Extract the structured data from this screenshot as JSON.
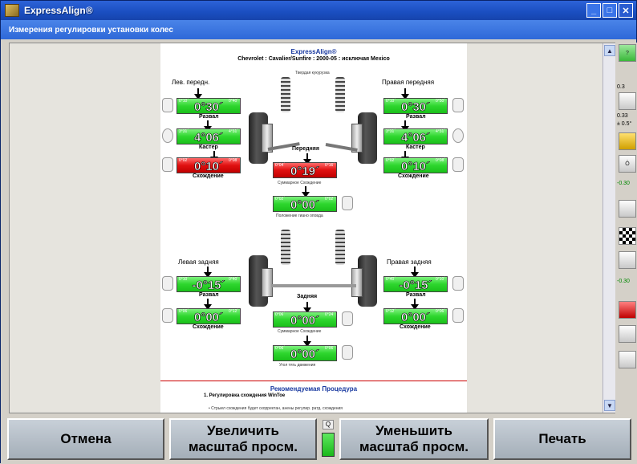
{
  "window": {
    "title": "ExpressAlign®",
    "subtitle": "Измерения регулировки установки колес"
  },
  "doc": {
    "brand": "ExpressAlign®",
    "vehicle": "Chevrolet : Cavalier/Sunfire : 2000-05 : исключая Mexico",
    "front_caption": "Твердая кукурузка",
    "front": {
      "left_title": "Лев. передн.",
      "right_title": "Правая передняя",
      "camber": {
        "left": "0°30´",
        "right": "0°30´",
        "label": "Развал",
        "left_lims": [
          "0°10´",
          "0°40´"
        ],
        "right_lims": [
          "0°10´",
          "0°50´"
        ]
      },
      "caster": {
        "left": "4°06´",
        "right": "4°06´",
        "label": "Кастер",
        "left_lims": [
          "3°31´",
          "4°31´"
        ],
        "right_lims": [
          "3°31´",
          "4°31´"
        ]
      },
      "toe": {
        "left": "0°10´",
        "right": "0°10´",
        "label": "Схождение",
        "left_lims": [
          "0°02´",
          "0°08´"
        ],
        "right_lims": [
          "0°02´",
          "0°08´"
        ]
      },
      "center_label": "Передняя",
      "total_toe": {
        "value": "0°19´",
        "label": "Суммарное Схождение",
        "lims": [
          "0°04´",
          "0°16´"
        ]
      },
      "setback": {
        "value": "0°00´",
        "label": "Положение гиано оповда",
        "lims": [
          "0°02´",
          "0°02´"
        ]
      }
    },
    "rear": {
      "left_title": "Левая задняя",
      "right_title": "Правая задняя",
      "camber": {
        "left": "-0°15´",
        "right": "-0°15´",
        "label": "Развал",
        "left_lims": [
          "0°10´",
          "0°40´"
        ],
        "right_lims": [
          "0°40´",
          "0°10´"
        ]
      },
      "toe": {
        "left": "0°00´",
        "right": "0°00´",
        "label": "Схождение",
        "left_lims": [
          "0°06´",
          "0°12´"
        ],
        "right_lims": [
          "0°12´",
          "0°06´"
        ]
      },
      "center_label": "Задняя",
      "total_toe": {
        "value": "0°00´",
        "label": "Суммарное Схождение",
        "lims": [
          "0°06´",
          "0°24´"
        ]
      },
      "thrust": {
        "value": "0°00´",
        "label": "Угол тягь движения",
        "lims": [
          "0°06´",
          "0°06´"
        ]
      }
    },
    "procedure_title": "Рекомендуемая Процедура",
    "procedure_item": "1.   Регулировка схождения WinToe",
    "procedure_note": "•    Стрыел схождения будет скорректан, анены регулир. ратд. схождения"
  },
  "sidebar": {
    "val1": "0.3",
    "val2": "0.33",
    "val3": "± 0.5°",
    "val4": "-0.30",
    "val5": "-0.30"
  },
  "buttons": {
    "cancel": "Отмена",
    "zoom_in_1": "Увеличить",
    "zoom_in_2": "масштаб просм.",
    "zoom_out_1": "Уменьшить",
    "zoom_out_2": "масштаб просм.",
    "print": "Печать",
    "zoom_q": "Q"
  },
  "colors": {
    "in_spec": "#2ed62e",
    "out_spec": "#e01010",
    "titlebar": "#1a4ec0"
  }
}
